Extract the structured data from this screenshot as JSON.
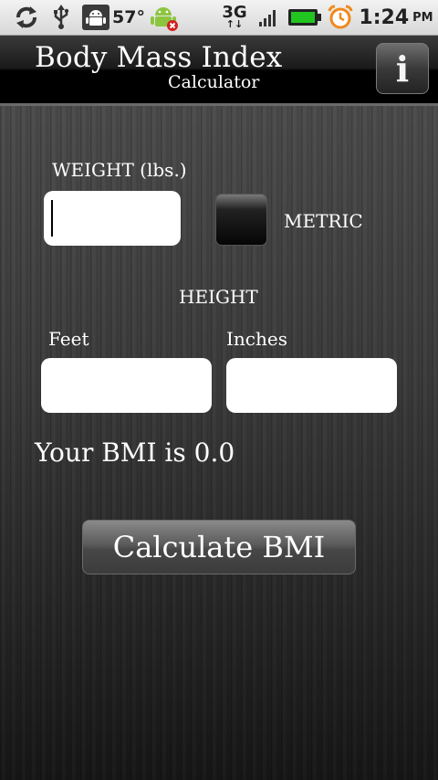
{
  "status_bar": {
    "icons": [
      "sync-icon",
      "usb-icon",
      "android-debug-icon",
      "android-alert-icon",
      "signal-icon",
      "battery-icon",
      "alarm-clock-icon"
    ],
    "temperature": "57°",
    "network": "3G",
    "network_arrows": "↑↓",
    "time": "1:24",
    "ampm": "PM",
    "battery_color": "#22c422",
    "alarm_color": "#f08a1c"
  },
  "header": {
    "title": "Body Mass Index",
    "subtitle": "Calculator",
    "info_label": "i"
  },
  "form": {
    "weight_label": "WEIGHT (lbs.)",
    "weight_value": "",
    "metric_label": "METRIC",
    "metric_checked": false,
    "height_label": "HEIGHT",
    "feet_label": "Feet",
    "feet_value": "",
    "inches_label": "Inches",
    "inches_value": ""
  },
  "result": {
    "text": "Your BMI is 0.0"
  },
  "actions": {
    "calculate_label": "Calculate BMI"
  }
}
